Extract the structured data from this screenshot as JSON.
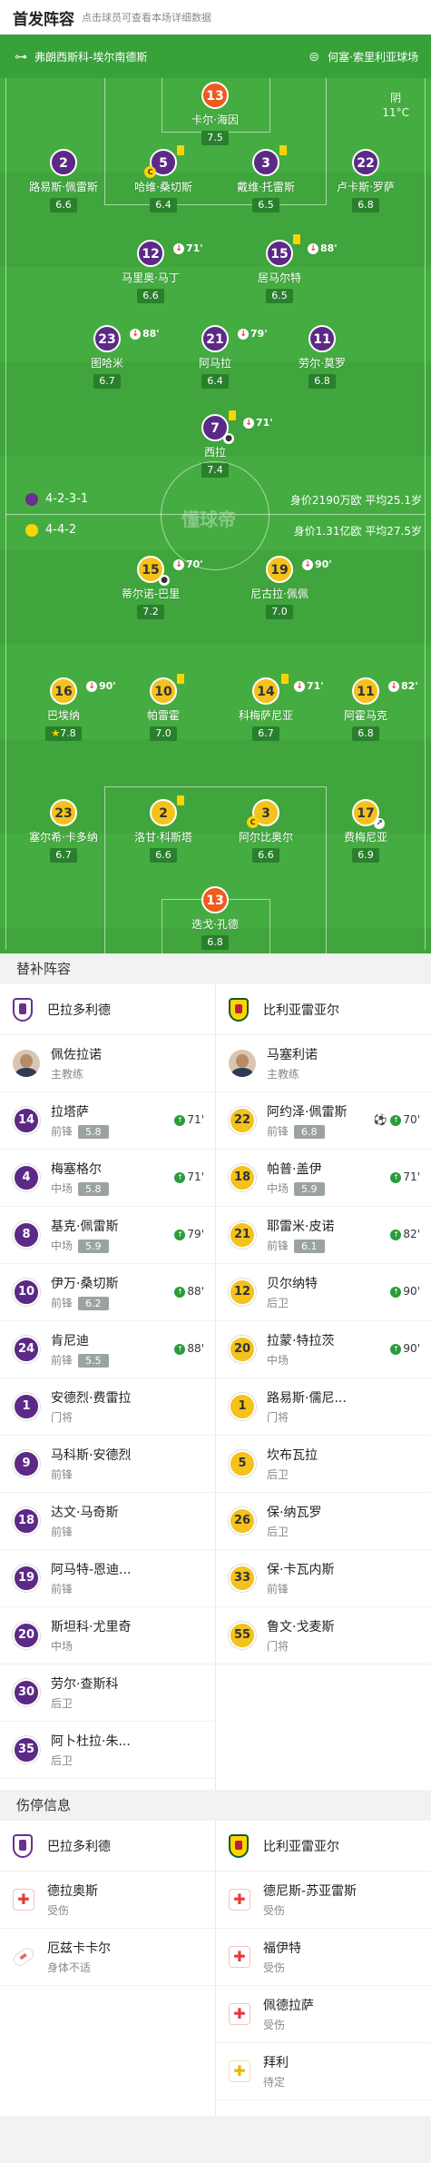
{
  "header": {
    "title": "首发阵容",
    "subtitle": "点击球员可查看本场详细数据"
  },
  "venue": {
    "city": "弗朗西斯科-埃尔南德斯",
    "stadium": "何塞·索里利亚球场"
  },
  "weather": {
    "condition": "阴",
    "temp": "11°C"
  },
  "watermark": "懂球帝",
  "home_team": {
    "name": "巴拉多利德",
    "formation": "4-2-3-1",
    "value_text": "身价2190万欧 平均25.1岁",
    "players": {
      "gk": {
        "number": "13",
        "name": "卡尔·海因",
        "rating": "7.5"
      },
      "lb": {
        "number": "2",
        "name": "路易斯·佩雷斯",
        "rating": "6.6"
      },
      "cb1": {
        "number": "5",
        "name": "哈维·桑切斯",
        "rating": "6.4"
      },
      "cb2": {
        "number": "3",
        "name": "戴维·托雷斯",
        "rating": "6.5"
      },
      "rb": {
        "number": "22",
        "name": "卢卡斯·罗萨",
        "rating": "6.8"
      },
      "dm1": {
        "number": "12",
        "name": "马里奥·马丁",
        "rating": "6.6",
        "sub": "71'"
      },
      "dm2": {
        "number": "15",
        "name": "居马尔特",
        "rating": "6.5",
        "sub": "88'"
      },
      "am1": {
        "number": "23",
        "name": "图哈米",
        "rating": "6.7",
        "sub": "88'"
      },
      "am2": {
        "number": "21",
        "name": "阿马拉",
        "rating": "6.4",
        "sub": "79'"
      },
      "am3": {
        "number": "11",
        "name": "劳尔·莫罗",
        "rating": "6.8"
      },
      "st": {
        "number": "7",
        "name": "西拉",
        "rating": "7.4",
        "sub": "71'"
      }
    }
  },
  "away_team": {
    "name": "比利亚雷亚尔",
    "formation": "4-4-2",
    "value_text": "身价1.31亿欧 平均27.5岁",
    "players": {
      "st1": {
        "number": "15",
        "name": "蒂尔诺-巴里",
        "rating": "7.2",
        "sub": "70'"
      },
      "st2": {
        "number": "19",
        "name": "尼古拉·佩佩",
        "rating": "7.0",
        "sub": "90'"
      },
      "lm": {
        "number": "16",
        "name": "巴埃纳",
        "rating": "7.8",
        "sub": "90'"
      },
      "cm1": {
        "number": "10",
        "name": "帕雷霍",
        "rating": "7.0"
      },
      "cm2": {
        "number": "14",
        "name": "科梅萨尼亚",
        "rating": "6.7",
        "sub": "71'"
      },
      "rm": {
        "number": "11",
        "name": "阿霍马克",
        "rating": "6.8",
        "sub": "82'"
      },
      "lb": {
        "number": "23",
        "name": "塞尔希·卡多纳",
        "rating": "6.7"
      },
      "cb1": {
        "number": "2",
        "name": "洛甘·科斯塔",
        "rating": "6.6"
      },
      "cb2": {
        "number": "3",
        "name": "阿尔比奥尔",
        "rating": "6.6"
      },
      "rb": {
        "number": "17",
        "name": "费梅尼亚",
        "rating": "6.9"
      },
      "gk": {
        "number": "13",
        "name": "迭戈·孔德",
        "rating": "6.8"
      }
    }
  },
  "subs_section": {
    "title": "替补阵容",
    "home": {
      "coach": {
        "name": "佩佐拉诺",
        "role": "主教练"
      },
      "players": [
        {
          "number": "14",
          "name": "拉塔萨",
          "pos": "前锋",
          "rating": "5.8",
          "minute": "71'"
        },
        {
          "number": "4",
          "name": "梅塞格尔",
          "pos": "中场",
          "rating": "5.8",
          "minute": "71'"
        },
        {
          "number": "8",
          "name": "基克·佩雷斯",
          "pos": "中场",
          "rating": "5.9",
          "minute": "79'"
        },
        {
          "number": "10",
          "name": "伊万·桑切斯",
          "pos": "前锋",
          "rating": "6.2",
          "minute": "88'"
        },
        {
          "number": "24",
          "name": "肯尼迪",
          "pos": "前锋",
          "rating": "5.5",
          "minute": "88'"
        },
        {
          "number": "1",
          "name": "安德烈·费雷拉",
          "pos": "门将"
        },
        {
          "number": "9",
          "name": "马科斯·安德烈",
          "pos": "前锋"
        },
        {
          "number": "18",
          "name": "达文·马奇斯",
          "pos": "前锋"
        },
        {
          "number": "19",
          "name": "阿马特-恩迪...",
          "pos": "前锋"
        },
        {
          "number": "20",
          "name": "斯坦科·尤里奇",
          "pos": "中场"
        },
        {
          "number": "30",
          "name": "劳尔·查斯科",
          "pos": "后卫"
        },
        {
          "number": "35",
          "name": "阿卜杜拉·朱...",
          "pos": "后卫"
        }
      ]
    },
    "away": {
      "coach": {
        "name": "马塞利诺",
        "role": "主教练"
      },
      "players": [
        {
          "number": "22",
          "name": "阿约泽·佩雷斯",
          "pos": "前锋",
          "rating": "6.8",
          "minute": "70'"
        },
        {
          "number": "18",
          "name": "帕普·盖伊",
          "pos": "中场",
          "rating": "5.9",
          "minute": "71'"
        },
        {
          "number": "21",
          "name": "耶雷米·皮诺",
          "pos": "前锋",
          "rating": "6.1",
          "minute": "82'"
        },
        {
          "number": "12",
          "name": "贝尔纳特",
          "pos": "后卫",
          "minute": "90'"
        },
        {
          "number": "20",
          "name": "拉蒙·特拉茨",
          "pos": "中场",
          "minute": "90'"
        },
        {
          "number": "1",
          "name": "路易斯·儒尼...",
          "pos": "门将"
        },
        {
          "number": "5",
          "name": "坎布瓦拉",
          "pos": "后卫"
        },
        {
          "number": "26",
          "name": "保·纳瓦罗",
          "pos": "后卫"
        },
        {
          "number": "33",
          "name": "保·卡瓦内斯",
          "pos": "前锋"
        },
        {
          "number": "55",
          "name": "鲁文·戈麦斯",
          "pos": "门将"
        }
      ]
    }
  },
  "injury_section": {
    "title": "伤停信息",
    "home": [
      {
        "name": "德拉奥斯",
        "status": "受伤",
        "icon": "medical-kit-icon"
      },
      {
        "name": "厄兹卡卡尔",
        "status": "身体不适",
        "icon": "pill-icon"
      }
    ],
    "away": [
      {
        "name": "德尼斯-苏亚雷斯",
        "status": "受伤",
        "icon": "medical-kit-icon"
      },
      {
        "name": "福伊特",
        "status": "受伤",
        "icon": "medical-kit-icon"
      },
      {
        "name": "佩德拉萨",
        "status": "受伤",
        "icon": "medical-kit-icon"
      },
      {
        "name": "拜利",
        "status": "待定",
        "icon": "pending-icon"
      }
    ]
  },
  "colors": {
    "pitch": "#3fa53c",
    "home_shirt": "#5c2a86",
    "away_shirt": "#f4c21b",
    "gk_shirt": "#ef5a1f"
  }
}
